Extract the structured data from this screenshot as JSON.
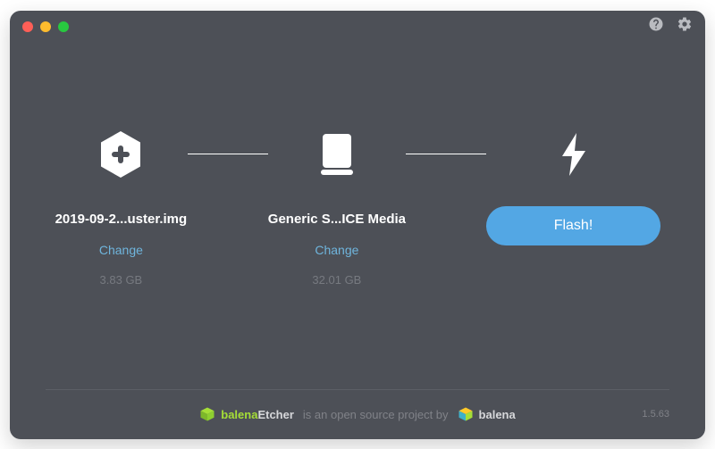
{
  "steps": {
    "image": {
      "title": "2019-09-2...uster.img",
      "change_label": "Change",
      "size": "3.83 GB"
    },
    "drive": {
      "title": "Generic S...ICE Media",
      "change_label": "Change",
      "size": "32.01 GB"
    },
    "flash": {
      "button_label": "Flash!"
    }
  },
  "footer": {
    "brand_primary_a": "balena",
    "brand_primary_b": "Etcher",
    "tagline": "is an open source project by",
    "brand_secondary": "balena",
    "version": "1.5.63"
  },
  "colors": {
    "background": "#4d5057",
    "accent": "#53a7e4",
    "link": "#6fb5dd",
    "brand_green": "#a5de37"
  }
}
